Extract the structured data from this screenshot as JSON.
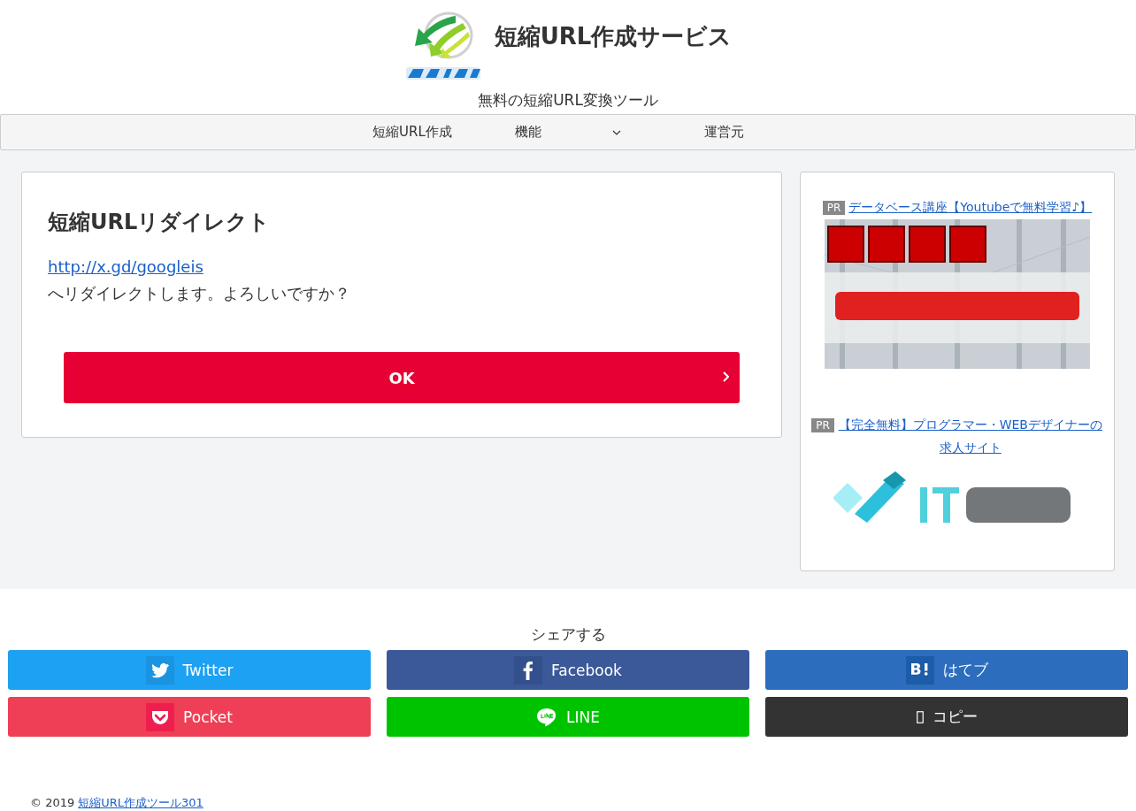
{
  "header": {
    "site_title": "短縮URL作成サービス",
    "tagline": "無料の短縮URL変換ツール"
  },
  "nav": [
    {
      "label": "短縮URL作成",
      "dropdown": false
    },
    {
      "label": "機能",
      "dropdown": true
    },
    {
      "label": "運営元",
      "dropdown": false
    }
  ],
  "main": {
    "heading": "短縮URLリダイレクト",
    "link": "http://x.gd/googleis",
    "message": "へリダイレクトします。よろしいですか？",
    "button": "OK"
  },
  "sidebar": {
    "ads": [
      {
        "badge": "PR",
        "title": "データベース講座【Youtubeで無料学習♪】"
      },
      {
        "badge": "PR",
        "title": "【完全無料】プログラマー・WEBデザイナーの求人サイト"
      }
    ]
  },
  "share": {
    "title": "シェアする",
    "buttons": [
      {
        "kind": "twitter",
        "label": "Twitter",
        "color": "#1da1f2"
      },
      {
        "kind": "facebook",
        "label": "Facebook",
        "color": "#3b5998"
      },
      {
        "kind": "hatena",
        "label": "はてブ",
        "color": "#2c6ebd"
      },
      {
        "kind": "pocket",
        "label": "Pocket",
        "color": "#ef3f56"
      },
      {
        "kind": "line",
        "label": "LINE",
        "color": "#00c300"
      },
      {
        "kind": "copy",
        "label": "コピー",
        "color": "#333333"
      }
    ]
  },
  "footer": {
    "copyright": "© 2019",
    "link": "短縮URL作成ツール301"
  }
}
